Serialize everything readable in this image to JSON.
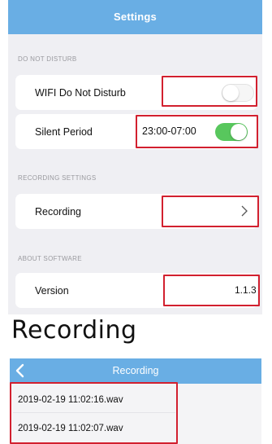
{
  "settings": {
    "title": "Settings",
    "sections": {
      "do_not_disturb": {
        "header": "DO NOT DISTURB",
        "wifi_dnd": {
          "label": "WIFI Do Not Disturb",
          "enabled": false
        },
        "silent_period": {
          "label": "Silent Period",
          "value": "23:00-07:00",
          "enabled": true
        }
      },
      "recording_settings": {
        "header": "RECORDING SETTINGS",
        "recording": {
          "label": "Recording",
          "chevron": ">"
        }
      },
      "about_software": {
        "header": "ABOUT SOFTWARE",
        "version": {
          "label": "Version",
          "value": "1.1.3"
        }
      }
    }
  },
  "caption": "Recording",
  "recording_screen": {
    "title": "Recording",
    "back_icon": "chevron-left-icon",
    "files": [
      "2019-02-19 11:02:16.wav",
      "2019-02-19 11:02:07.wav"
    ]
  },
  "colors": {
    "nav_blue": "#69aee4",
    "highlight_red": "#d2202f",
    "toggle_green": "#58c75d",
    "background_gray": "#efeff3"
  }
}
